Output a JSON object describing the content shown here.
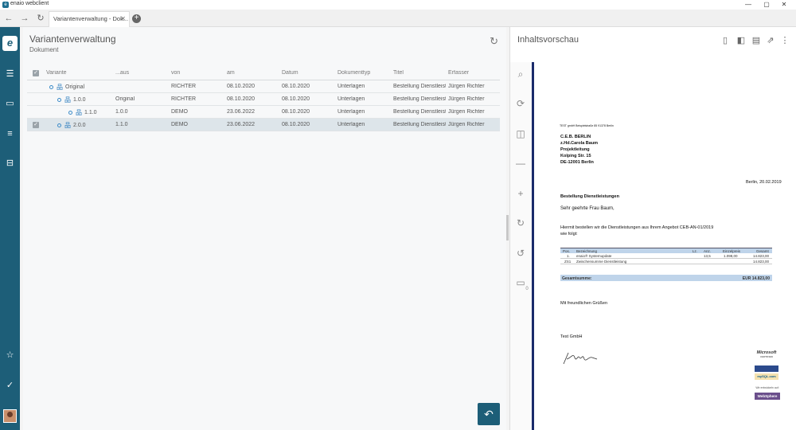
{
  "window": {
    "title": "enaio webclient",
    "minimize": "—",
    "maximize": "▢",
    "close": "✕"
  },
  "browser": {
    "tab_title": "Variantenverwaltung - Dok...",
    "tab_close": "✕",
    "back_icon": "arrow-left",
    "forward_icon": "arrow-right",
    "reload_icon": "reload",
    "newtab_label": "+"
  },
  "sidebar": {
    "logo": "e",
    "items": [
      "stack-icon",
      "monitor-icon",
      "list-icon",
      "inbox-icon",
      "star-icon",
      "check-circle-icon"
    ]
  },
  "variant_panel": {
    "title": "Variantenverwaltung",
    "subtitle": "Dokument",
    "columns": [
      "Variante",
      "...aus",
      "von",
      "am",
      "Datum",
      "Dokumenttyp",
      "Titel",
      "Erfasser"
    ],
    "rows": [
      {
        "variant": "Original",
        "depth": 0,
        "aus": "",
        "von": "RICHTER",
        "am": "08.10.2020",
        "datum": "08.10.2020",
        "typ": "Unterlagen",
        "titel": "Bestellung Dienstleist",
        "erfasser": "Jürgen Richter",
        "checked": false,
        "selected": false
      },
      {
        "variant": "1.0.0",
        "depth": 1,
        "aus": "Original",
        "von": "RICHTER",
        "am": "08.10.2020",
        "datum": "08.10.2020",
        "typ": "Unterlagen",
        "titel": "Bestellung Dienstleist",
        "erfasser": "Jürgen Richter",
        "checked": false,
        "selected": false
      },
      {
        "variant": "1.1.0",
        "depth": 2,
        "aus": "1.0.0",
        "von": "DEMO",
        "am": "23.06.2022",
        "datum": "08.10.2020",
        "typ": "Unterlagen",
        "titel": "Bestellung Dienstleist",
        "erfasser": "Jürgen Richter",
        "checked": false,
        "selected": false
      },
      {
        "variant": "2.0.0",
        "depth": 1,
        "aus": "1.1.0",
        "von": "DEMO",
        "am": "23.06.2022",
        "datum": "08.10.2020",
        "typ": "Unterlagen",
        "titel": "Bestellung Dienstleist",
        "erfasser": "Jürgen Richter",
        "checked": true,
        "selected": true
      }
    ],
    "back_button": "↶"
  },
  "preview": {
    "title": "Inhaltsvorschau",
    "toolbar": [
      "document-icon",
      "split-icon",
      "table-icon",
      "external-icon",
      "more-icon"
    ],
    "tools": [
      "search-icon",
      "sync-icon",
      "layout-icon",
      "zoom-out-icon",
      "zoom-in-icon",
      "rotate-cw-icon",
      "rotate-ccw-icon",
      "comment-icon"
    ],
    "comment_count": "0",
    "document": {
      "sender_line": "TEST gmbH Beispielstraße 85 91378 Berlin",
      "address": [
        "C.E.B. BERLIN",
        "z.Hd.Carola Baum",
        "Projektleitung",
        "Kolping Str. 15",
        "DE-12001 Berlin"
      ],
      "date": "Berlin, 20.02.2019",
      "subject": "Bestellung Dienstleistungen",
      "salutation": "Sehr geehrte Frau Baum,",
      "body_line1": "Hiermit bestellen wir die Dienstleistungen aus Ihrem Angebot CEB-AN-01/2019",
      "body_line2": "wie folgt:",
      "table_headers": [
        "Pos.",
        "Bezeichnung",
        "Lz.",
        "Anz.",
        "Einzelpreis",
        "Gesamt"
      ],
      "table_rows": [
        [
          "1.",
          "enaio® Systemupdate",
          "",
          "13,5",
          "1.098,00",
          "14.823,00"
        ],
        [
          "ZS1",
          "Zwischensumme Dienstleistung",
          "",
          "",
          "",
          "14.823,00"
        ]
      ],
      "total_label": "Gesamtsumme:",
      "total_value": "EUR 14.823,00",
      "closing": "Mit freundlichen Grüßen",
      "company": "Test GmbH",
      "logo_microsoft": "Microsoft",
      "logo_certified": "CERTIFIED",
      "logo_mysql": "mySQL.com",
      "logo_we_support": "Wir entwickeln auf:",
      "logo_websphere": "WebSphere"
    }
  }
}
